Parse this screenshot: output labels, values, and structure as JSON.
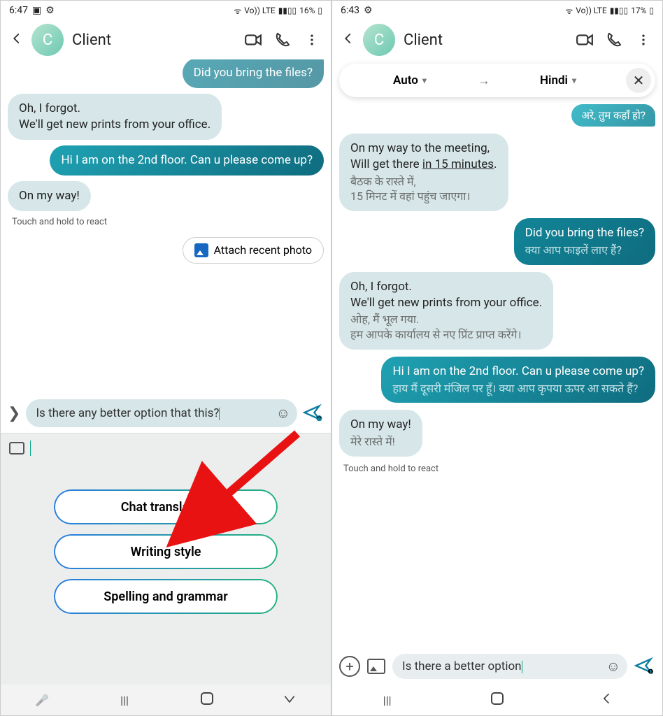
{
  "left": {
    "status": {
      "time": "6:47",
      "battery": "16%",
      "lte": "Vo)) LTE"
    },
    "header": {
      "avatar_letter": "C",
      "name": "Client"
    },
    "msgs": {
      "out_hidden": "Did you bring the files?",
      "in1": "Oh, I forgot.\nWe'll get new prints from your office.",
      "out1": "Hi I am on the 2nd floor. Can u please come up?",
      "in2": "On my way!",
      "hint": "Touch and hold to react",
      "attach": "Attach recent photo",
      "compose": "Is there any better option that this?"
    },
    "suggestions": {
      "s1": "Chat translation",
      "s2": "Writing style",
      "s3": "Spelling and grammar"
    }
  },
  "right": {
    "status": {
      "time": "6:43",
      "battery": "17%",
      "lte": "Vo)) LTE"
    },
    "header": {
      "avatar_letter": "C",
      "name": "Client"
    },
    "translate": {
      "from": "Auto",
      "to": "Hindi"
    },
    "msgs": {
      "out_partial": "अरे, तुम कहाँ हो?",
      "in1_a": "On my way to the meeting,",
      "in1_b_pre": "Will get there ",
      "in1_b_und": "in 15 minutes",
      "in1_b_post": ".",
      "in1_t": "बैठक के रास्ते में,\n15 मिनट में वहां पहुंच जाएगा।",
      "out1": "Did you bring the files?",
      "out1_t": "क्या आप फाइलें लाए हैं?",
      "in2": "Oh, I forgot.\nWe'll get new prints from your office.",
      "in2_t": "ओह, मैं भूल गया.\nहम आपके कार्यालय से नए प्रिंट प्राप्त करेंगे।",
      "out2": "Hi I am on the 2nd floor. Can u please come up?",
      "out2_t": "हाय मैं दूसरी मंजिल पर हूँ। क्या आप कृपया ऊपर आ सकते हैं?",
      "in3": "On my way!",
      "in3_t": "मेरे रास्ते में!",
      "hint": "Touch and hold to react",
      "compose": "Is there a better option"
    }
  }
}
